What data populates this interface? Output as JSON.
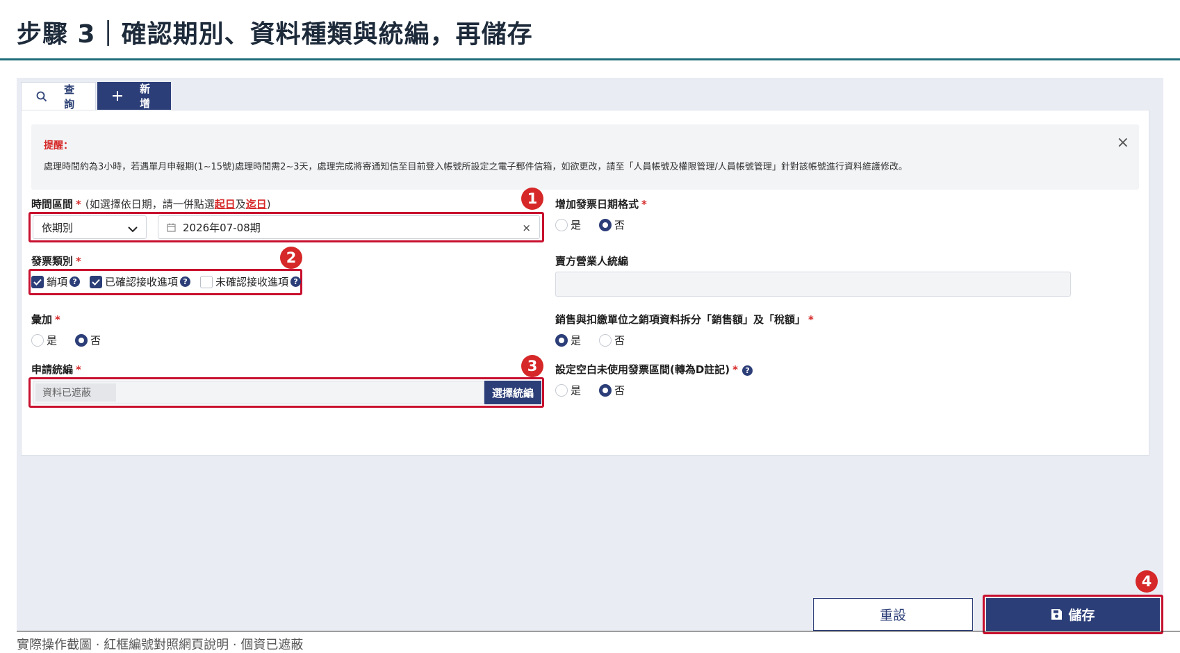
{
  "heading": "步驟 3｜確認期別、資料種類與統編，再儲存",
  "tabs": [
    {
      "label": "查詢",
      "icon": "search-icon"
    },
    {
      "label": "新增",
      "icon": "plus-icon"
    }
  ],
  "notice": {
    "title": "提醒：",
    "body": "處理時間約為3小時，若遇單月申報期(1~15號)處理時間需2~3天，處理完成將寄通知信至目前登入帳號所設定之電子郵件信箱，如欲更改，請至「人員帳號及權限管理/人員帳號管理」針對該帳號進行資料維護修改。",
    "close": "×"
  },
  "required_mark": "*",
  "time_range": {
    "label": "時間區間",
    "hint_prefix": "(如選擇依日期，請一併點選",
    "hint_start": "起日",
    "hint_mid": "及",
    "hint_end": "迄日",
    "hint_suffix": ")",
    "period_select": "依期別",
    "period_value": "2026年07-08期",
    "clear": "×"
  },
  "invoice_type": {
    "label": "發票類別",
    "options": [
      {
        "label": "銷項",
        "checked": true
      },
      {
        "label": "已確認接收進項",
        "checked": true
      },
      {
        "label": "未確認接收進項",
        "checked": false
      }
    ],
    "help": "?"
  },
  "aggregate": {
    "label": "彙加",
    "options": [
      {
        "label": "是",
        "selected": false
      },
      {
        "label": "否",
        "selected": true
      }
    ]
  },
  "apply_tax_id": {
    "label": "申請統編",
    "value": "資料已遮蔽",
    "button": "選擇統編"
  },
  "add_date_format": {
    "label": "增加發票日期格式",
    "options": [
      {
        "label": "是",
        "selected": false
      },
      {
        "label": "否",
        "selected": true
      }
    ]
  },
  "seller_tax_id": {
    "label": "賣方營業人統編",
    "value": ""
  },
  "split_sales": {
    "label": "銷售與扣繳單位之銷項資料拆分「銷售額」及「稅額」",
    "options": [
      {
        "label": "是",
        "selected": true
      },
      {
        "label": "否",
        "selected": false
      }
    ]
  },
  "blank_range": {
    "label": "設定空白未使用發票區間(轉為D註記)",
    "help": "?",
    "options": [
      {
        "label": "是",
        "selected": false
      },
      {
        "label": "否",
        "selected": true
      }
    ]
  },
  "badges": [
    "1",
    "2",
    "3",
    "4"
  ],
  "actions": {
    "reset": "重設",
    "save": "儲存"
  },
  "caption": "實際操作截圖 · 紅框編號對照網頁說明 · 個資已遮蔽",
  "colors": {
    "accent": "#2c3e78",
    "highlight": "#c8102e",
    "rule": "#1f6e7a"
  }
}
